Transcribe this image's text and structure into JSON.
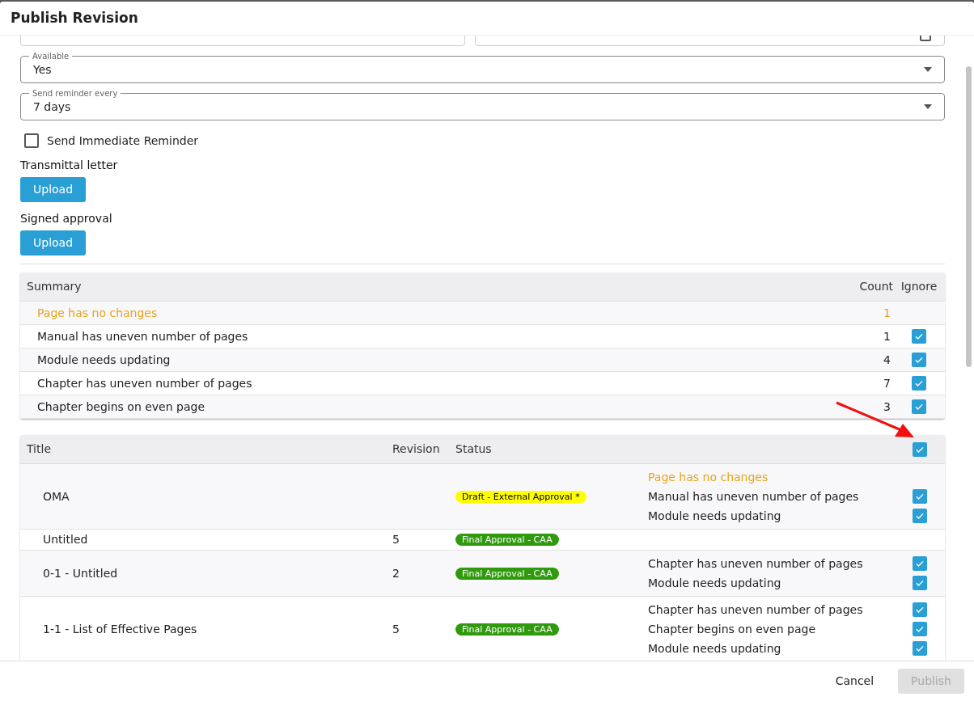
{
  "dialog": {
    "title": "Publish Revision"
  },
  "fields": [
    {
      "kind": "text"
    },
    {
      "kind": "date"
    }
  ],
  "selects": [
    {
      "label": "Available",
      "value": "Yes"
    },
    {
      "label": "Send reminder every",
      "value": "7 days"
    }
  ],
  "immediate_reminder": {
    "label": "Send Immediate Reminder",
    "checked": false
  },
  "uploads": [
    {
      "label": "Transmittal letter",
      "button": "Upload"
    },
    {
      "label": "Signed approval",
      "button": "Upload"
    }
  ],
  "summary": {
    "columns": [
      "Summary",
      "Count",
      "Ignore"
    ],
    "rows": [
      {
        "kind": "notice",
        "text": "Page has no changes",
        "count": "1"
      },
      {
        "kind": "issue",
        "text": "Manual has uneven number of pages",
        "count": "1",
        "ignored": true
      },
      {
        "kind": "issue",
        "text": "Module needs updating",
        "count": "4",
        "ignored": true
      },
      {
        "kind": "issue",
        "text": "Chapter has uneven number of pages",
        "count": "7",
        "ignored": true
      },
      {
        "kind": "issue",
        "text": "Chapter begins on even page",
        "count": "3",
        "ignored": true
      }
    ]
  },
  "items": {
    "columns": [
      "Title",
      "Revision",
      "Status"
    ],
    "all_ignored": true,
    "rows": [
      {
        "title": "OMA",
        "status": {
          "kind": "draft",
          "text": "Draft - External Approval *",
          "color": "#ffff00"
        },
        "issues": [
          {
            "kind": "notice",
            "text": "Page has no changes"
          },
          {
            "kind": "issue",
            "text": "Manual has uneven number of pages",
            "ignored": true
          },
          {
            "kind": "issue",
            "text": "Module needs updating",
            "ignored": true
          }
        ]
      },
      {
        "title": "Untitled",
        "revision": "5",
        "status": {
          "kind": "final",
          "text": "Final Approval - CAA",
          "color": "#2e9a0c"
        },
        "issues": []
      },
      {
        "title": "0-1 - Untitled",
        "revision": "2",
        "status": {
          "kind": "final",
          "text": "Final Approval - CAA",
          "color": "#2e9a0c"
        },
        "issues": [
          {
            "kind": "issue",
            "text": "Chapter has uneven number of pages",
            "ignored": true
          },
          {
            "kind": "issue",
            "text": "Module needs updating",
            "ignored": true
          }
        ]
      },
      {
        "title": "1-1 - List of Effective Pages",
        "revision": "5",
        "status": {
          "kind": "final",
          "text": "Final Approval - CAA",
          "color": "#2e9a0c"
        },
        "issues": [
          {
            "kind": "issue",
            "text": "Chapter has uneven number of pages",
            "ignored": true
          },
          {
            "kind": "issue",
            "text": "Chapter begins on even page",
            "ignored": true
          },
          {
            "kind": "issue",
            "text": "Module needs updating",
            "ignored": true
          }
        ]
      }
    ]
  },
  "actions": [
    {
      "kind": "secondary",
      "label": "Cancel",
      "disabled": false
    },
    {
      "kind": "primary",
      "label": "Publish",
      "disabled": true
    }
  ]
}
